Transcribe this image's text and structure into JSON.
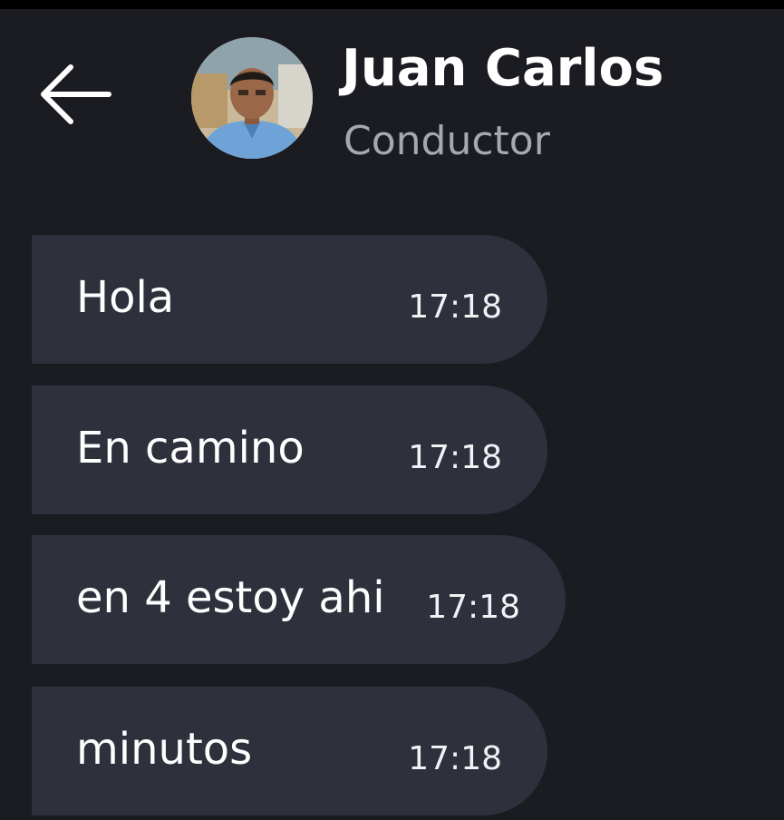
{
  "header": {
    "back_icon": "arrow-left-icon",
    "contact": {
      "name": "Juan Carlos",
      "role": "Conductor",
      "avatar": "contact-photo"
    }
  },
  "messages": [
    {
      "text": "Hola",
      "time": "17:18"
    },
    {
      "text": "En camino",
      "time": "17:18"
    },
    {
      "text": "en 4 estoy ahi",
      "time": "17:18"
    },
    {
      "text": "minutos",
      "time": "17:18"
    }
  ],
  "colors": {
    "background": "#1b1b22",
    "bubble": "#2e303c",
    "name": "#ffffff",
    "role": "#a7a7af"
  }
}
